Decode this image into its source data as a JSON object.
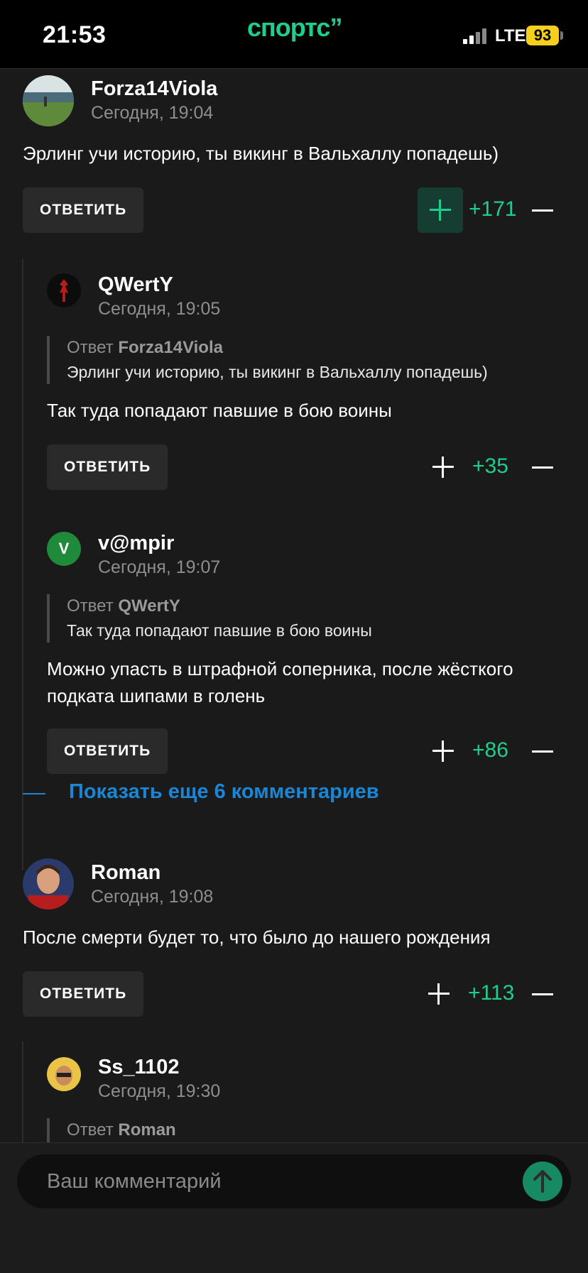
{
  "status_bar": {
    "time": "21:53",
    "brand": "спортс”",
    "network": "LTE",
    "battery": "93"
  },
  "comments": [
    {
      "author": "Forza14Viola",
      "date": "Сегодня, 19:04",
      "text": "Эрлинг учи историю, ты викинг в Вальхаллу попадешь)",
      "reply": "ОТВЕТИТЬ",
      "score": "+171",
      "upvoted": true
    },
    {
      "author": "QWertY",
      "date": "Сегодня, 19:05",
      "quote_prefix": "Ответ",
      "quote_author": "Forza14Viola",
      "quote_text": "Эрлинг учи историю, ты викинг в Вальхаллу попадешь)",
      "text": "Так туда попадают павшие в бою воины",
      "reply": "ОТВЕТИТЬ",
      "score": "+35"
    },
    {
      "author": "v@mpir",
      "avatar_letter": "V",
      "date": "Сегодня, 19:07",
      "quote_prefix": "Ответ",
      "quote_author": "QWertY",
      "quote_text": "Так туда попадают павшие в бою воины",
      "text": "Можно упасть в штрафной соперника, после жёсткого подката шипами в голень",
      "reply": "ОТВЕТИТЬ",
      "score": "+86"
    },
    {
      "author": "Roman",
      "date": "Сегодня, 19:08",
      "text": "После смерти будет то, что было до нашего рождения",
      "reply": "ОТВЕТИТЬ",
      "score": "+113"
    },
    {
      "author": "Ss_1102",
      "date": "Сегодня, 19:30",
      "quote_prefix": "Ответ",
      "quote_author": "Roman"
    }
  ],
  "show_more": "Показать еще 6 комментариев",
  "composer": {
    "placeholder": "Ваш комментарий"
  },
  "colors": {
    "accent_green": "#1fce8e",
    "link_blue": "#1b86d6",
    "background": "#1a1a1a"
  }
}
